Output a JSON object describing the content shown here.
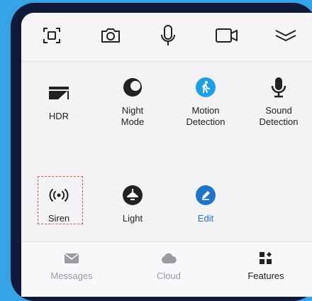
{
  "colors": {
    "background": "#35a3e6",
    "accent_blue": "#1f9ee8",
    "edit_blue": "#1f73c9",
    "icon_dark": "#222222",
    "inactive": "#9a9aa0",
    "highlight_dashed": "#e25b4b"
  },
  "toolbar": {
    "items": [
      {
        "icon": "screen-capture-icon"
      },
      {
        "icon": "camera-icon"
      },
      {
        "icon": "microphone-icon"
      },
      {
        "icon": "video-camera-icon"
      },
      {
        "icon": "collapse-chevron-icon"
      }
    ]
  },
  "features": {
    "hdr": {
      "label": "HDR",
      "icon": "hdr-icon"
    },
    "night_mode": {
      "label": "Night\nMode",
      "icon": "moon-icon"
    },
    "motion_detection": {
      "label": "Motion\nDetection",
      "icon": "person-walking-icon"
    },
    "sound_detection": {
      "label": "Sound\nDetection",
      "icon": "microphone-icon"
    },
    "siren": {
      "label": "Siren",
      "icon": "siren-icon"
    },
    "light": {
      "label": "Light",
      "icon": "lamp-icon"
    },
    "edit": {
      "label": "Edit",
      "icon": "pencil-icon"
    }
  },
  "bottom_nav": {
    "messages": {
      "label": "Messages",
      "icon": "envelope-icon"
    },
    "cloud": {
      "label": "Cloud",
      "icon": "cloud-icon"
    },
    "features": {
      "label": "Features",
      "icon": "features-grid-icon",
      "active": true
    }
  }
}
